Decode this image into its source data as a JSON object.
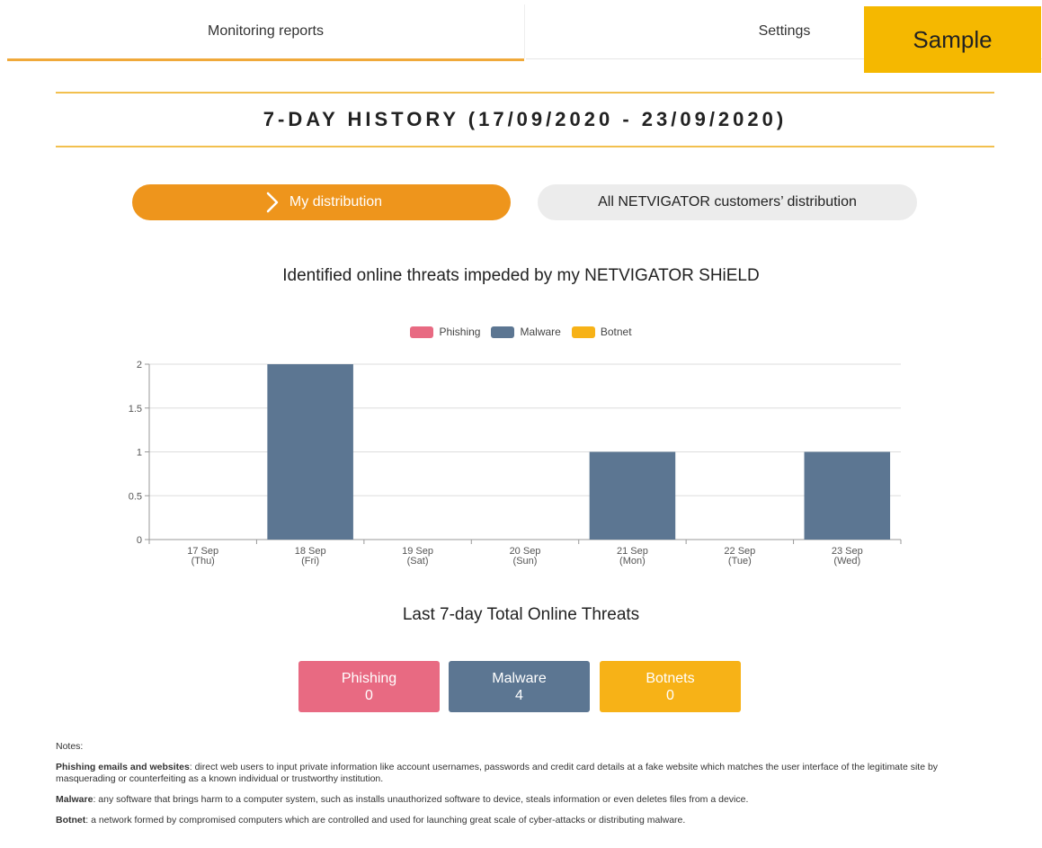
{
  "tabs": {
    "monitoring": "Monitoring reports",
    "settings": "Settings"
  },
  "sample_label": "Sample",
  "history_title": "7-DAY HISTORY (17/09/2020 - 23/09/2020)",
  "distribution": {
    "mine": "My distribution",
    "all": "All NETVIGATOR customers’ distribution"
  },
  "chart_title": "Identified online threats impeded by my NETVIGATOR SHiELD",
  "legend": {
    "phishing": "Phishing",
    "malware": "Malware",
    "botnet": "Botnet"
  },
  "colors": {
    "accent": "#ee951c",
    "phishing": "#e86a82",
    "malware": "#5c7692",
    "botnet": "#f7b217"
  },
  "chart_data": {
    "type": "bar",
    "categories": [
      [
        "17 Sep",
        "(Thu)"
      ],
      [
        "18 Sep",
        "(Fri)"
      ],
      [
        "19 Sep",
        "(Sat)"
      ],
      [
        "20 Sep",
        "(Sun)"
      ],
      [
        "21 Sep",
        "(Mon)"
      ],
      [
        "22 Sep",
        "(Tue)"
      ],
      [
        "23 Sep",
        "(Wed)"
      ]
    ],
    "series": [
      {
        "name": "Phishing",
        "color": "#e86a82",
        "values": [
          0,
          0,
          0,
          0,
          0,
          0,
          0
        ]
      },
      {
        "name": "Malware",
        "color": "#5c7692",
        "values": [
          0,
          2,
          0,
          0,
          1,
          0,
          1
        ]
      },
      {
        "name": "Botnet",
        "color": "#f7b217",
        "values": [
          0,
          0,
          0,
          0,
          0,
          0,
          0
        ]
      }
    ],
    "y_ticks": [
      "0",
      "0.5",
      "1",
      "1.5",
      "2"
    ],
    "ylim": [
      0,
      2
    ],
    "grid": true,
    "legend_position": "top-center"
  },
  "totals": {
    "title": "Last 7-day Total Online Threats",
    "phishing": {
      "label": "Phishing",
      "count": "0"
    },
    "malware": {
      "label": "Malware",
      "count": "4"
    },
    "botnets": {
      "label": "Botnets",
      "count": "0"
    }
  },
  "notes": {
    "heading": "Notes:",
    "phishing_term": "Phishing emails and websites",
    "phishing_desc": ": direct web users to input private information like account usernames, passwords and credit card details at a fake website which matches the user interface of the legitimate site by masquerading or counterfeiting as a known individual or trustworthy institution.",
    "malware_term": "Malware",
    "malware_desc": ": any software that brings harm to a computer system, such as installs unauthorized software to device, steals information or even deletes files from a device.",
    "botnet_term": "Botnet",
    "botnet_desc": ": a network formed by compromised computers which are controlled and used for launching great scale of cyber-attacks or distributing malware."
  }
}
